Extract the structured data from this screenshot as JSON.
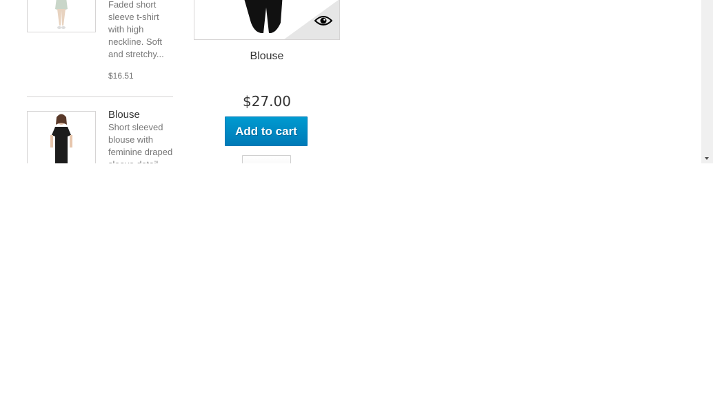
{
  "products_list": [
    {
      "description": "Faded short sleeve t-shirt with high neckline. Soft and stretchy...",
      "price": "$16.51"
    },
    {
      "title": "Blouse",
      "description": "Short sleeved blouse with feminine draped sleeve detail"
    }
  ],
  "card": {
    "name": "Blouse",
    "price": "$27.00",
    "add_to_cart": "Add to cart",
    "quick_view_icon": "eye-icon"
  },
  "colors": {
    "accent": "#0089c4",
    "text": "#333333",
    "muted": "#777777",
    "border": "#d6d4d4"
  }
}
